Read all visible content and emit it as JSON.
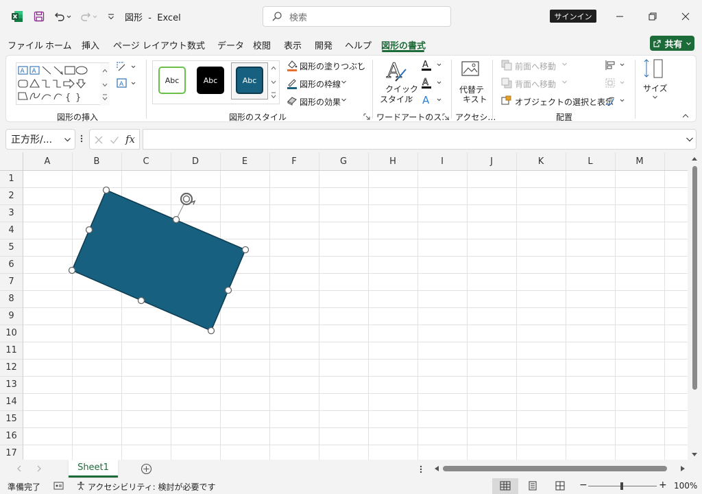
{
  "app": {
    "doc_name": "図形",
    "separator": "-",
    "app_name": "Excel",
    "search_placeholder": "検索",
    "signin_label": "サインイン"
  },
  "menu": {
    "tabs": [
      "ファイル",
      "ホーム",
      "挿入",
      "ページ レイアウト",
      "数式",
      "データ",
      "校閲",
      "表示",
      "開発",
      "ヘルプ",
      "図形の書式"
    ],
    "active_tab": "図形の書式",
    "share_label": "共有"
  },
  "ribbon": {
    "insert_shapes": {
      "label": "図形の挿入"
    },
    "shape_styles": {
      "label": "図形のスタイル",
      "style_samples": [
        "Abc",
        "Abc",
        "Abc"
      ],
      "fill_label": "図形の塗りつぶし",
      "outline_label": "図形の枠線",
      "effects_label": "図形の効果"
    },
    "wordart": {
      "label": "ワードアートのス…",
      "quick_style_line1": "クイック",
      "quick_style_line2": "スタイル"
    },
    "accessibility": {
      "label": "アクセシ…",
      "alt_text_line1": "代替テ",
      "alt_text_line2": "キスト"
    },
    "arrange": {
      "label": "配置",
      "bring_forward": "前面へ移動",
      "send_backward": "背面へ移動",
      "selection_pane": "オブジェクトの選択と表示"
    },
    "size": {
      "label": "サイズ"
    }
  },
  "formula_bar": {
    "name_box": "正方形/...",
    "formula": "",
    "fx_label": "fx"
  },
  "grid": {
    "columns": [
      "A",
      "B",
      "C",
      "D",
      "E",
      "F",
      "G",
      "H",
      "I",
      "J",
      "K",
      "L",
      "M"
    ],
    "rows": [
      "1",
      "2",
      "3",
      "4",
      "5",
      "6",
      "7",
      "8",
      "9",
      "10",
      "11",
      "12",
      "13",
      "14",
      "15",
      "16",
      "17"
    ],
    "shape_fill": "#17607f"
  },
  "sheets": {
    "tabs": [
      "Sheet1"
    ],
    "active": "Sheet1"
  },
  "status": {
    "ready": "準備完了",
    "accessibility": "アクセシビリティ: 検討が必要です",
    "zoom": "100%"
  },
  "colors": {
    "accent": "#1e6b3a",
    "fill_bar": "#e3702e",
    "outline_bar": "#17607f"
  }
}
